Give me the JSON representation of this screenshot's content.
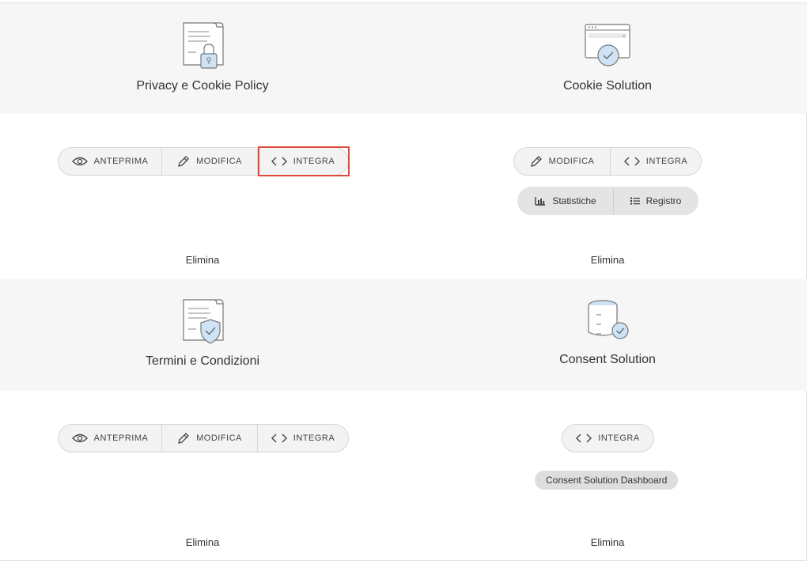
{
  "cards": [
    {
      "title": "Privacy e Cookie Policy",
      "icon": "document-lock-icon",
      "buttons": [
        {
          "label": "ANTEPRIMA",
          "icon": "eye-icon"
        },
        {
          "label": "MODIFICA",
          "icon": "pencil-icon"
        },
        {
          "label": "INTEGRA",
          "icon": "code-icon"
        }
      ],
      "delete_label": "Elimina"
    },
    {
      "title": "Cookie Solution",
      "icon": "browser-cookie-icon",
      "buttons": [
        {
          "label": "MODIFICA",
          "icon": "pencil-icon"
        },
        {
          "label": "INTEGRA",
          "icon": "code-icon"
        }
      ],
      "secondary_buttons": [
        {
          "label": "Statistiche",
          "icon": "bar-chart-icon"
        },
        {
          "label": "Registro",
          "icon": "list-icon"
        }
      ],
      "delete_label": "Elimina"
    },
    {
      "title": "Termini e Condizioni",
      "icon": "document-shield-icon",
      "buttons": [
        {
          "label": "ANTEPRIMA",
          "icon": "eye-icon"
        },
        {
          "label": "MODIFICA",
          "icon": "pencil-icon"
        },
        {
          "label": "INTEGRA",
          "icon": "code-icon"
        }
      ],
      "delete_label": "Elimina"
    },
    {
      "title": "Consent Solution",
      "icon": "database-check-icon",
      "buttons": [
        {
          "label": "INTEGRA",
          "icon": "code-icon"
        }
      ],
      "dashboard_label": "Consent Solution Dashboard",
      "delete_label": "Elimina"
    }
  ],
  "colors": {
    "band": "#f6f6f6",
    "button_bg": "#f3f3f3",
    "highlight": "#e04a3a",
    "icon_accent": "#cfe3f7"
  }
}
